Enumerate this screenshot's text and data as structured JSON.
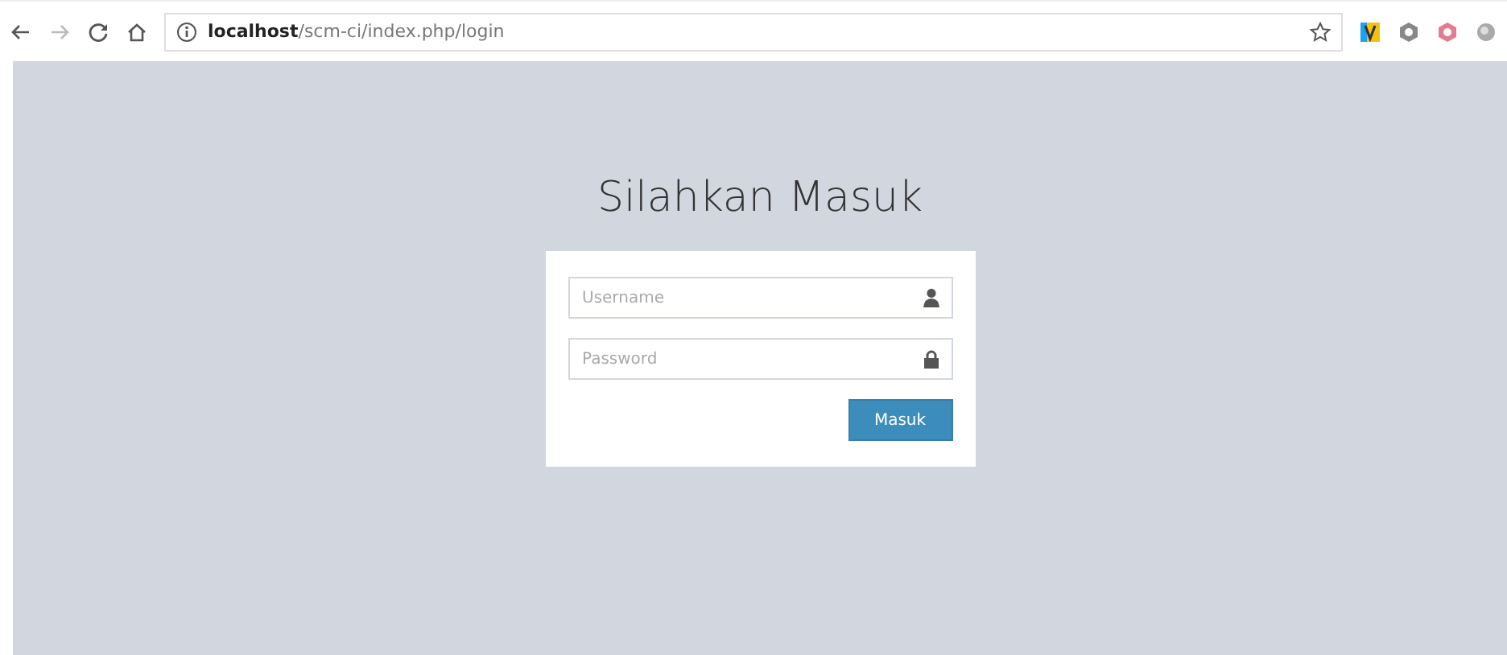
{
  "browser": {
    "url": "**localhost**/scm-ci/index.php/login"
  },
  "page": {
    "title": "Silahkan Masuk",
    "fields": [
      {
        "placeholder": "Username",
        "kind": "user"
      },
      {
        "placeholder": "Password",
        "kind": "lock"
      }
    ],
    "button": "Masuk"
  }
}
